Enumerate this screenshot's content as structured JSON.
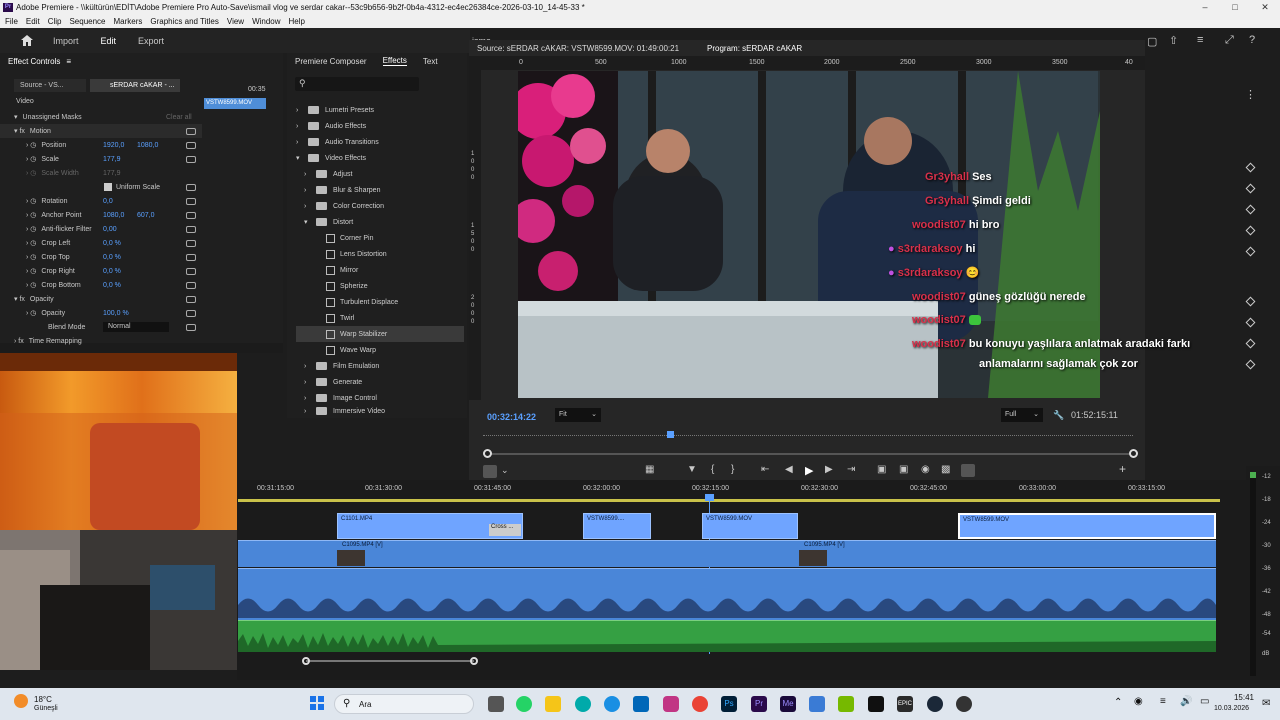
{
  "window": {
    "title": "Adobe Premiere - \\\\kültürün\\EDİT\\Adobe Premiere Pro Auto-Save\\ismail vlog ve serdar cakar--53c9b656-9b2f-0b4a-4312-ec4ec26384ce-2026-03-10_14-45-33 *",
    "logo": "Pr"
  },
  "menu": [
    "File",
    "Edit",
    "Clip",
    "Sequence",
    "Markers",
    "Graphics and Titles",
    "View",
    "Window",
    "Help"
  ],
  "header": {
    "home_icon": "home-icon",
    "import": "Import",
    "edit": "Edit",
    "export": "Export",
    "user": "isma"
  },
  "effect_controls": {
    "title": "Effect Controls",
    "source_tab": "Source - VS...",
    "program_tab": "sERDAR cAKAR - ...",
    "timecode": "00:35",
    "clip_label": "VSTW8599.MOV",
    "section_video": "Video",
    "rows": [
      {
        "label": "Unassigned Masks",
        "value1": "",
        "value2": "",
        "extra": "Clear all"
      },
      {
        "label": "Motion",
        "value1": "",
        "value2": ""
      },
      {
        "label": "Position",
        "value1": "1920,0",
        "value2": "1080,0"
      },
      {
        "label": "Scale",
        "value1": "177,9",
        "value2": ""
      },
      {
        "label": "Scale Width",
        "value1": "177,9",
        "value2": ""
      },
      {
        "label": "Uniform Scale",
        "value1": "",
        "value2": ""
      },
      {
        "label": "Rotation",
        "value1": "0,0",
        "value2": ""
      },
      {
        "label": "Anchor Point",
        "value1": "1080,0",
        "value2": "607,0"
      },
      {
        "label": "Anti-flicker Filter",
        "value1": "0,00",
        "value2": ""
      },
      {
        "label": "Crop Left",
        "value1": "0,0 %",
        "value2": ""
      },
      {
        "label": "Crop Top",
        "value1": "0,0 %",
        "value2": ""
      },
      {
        "label": "Crop Right",
        "value1": "0,0 %",
        "value2": ""
      },
      {
        "label": "Crop Bottom",
        "value1": "0,0 %",
        "value2": ""
      },
      {
        "label": "Opacity",
        "value1": "",
        "value2": ""
      },
      {
        "label": "Opacity",
        "value1": "100,0 %",
        "value2": ""
      },
      {
        "label": "Blend Mode",
        "value1": "Normal",
        "value2": ""
      },
      {
        "label": "Time Remapping",
        "value1": "",
        "value2": ""
      }
    ]
  },
  "effects_panel": {
    "tabs": [
      "Premiere Composer",
      "Effects",
      "Text"
    ],
    "items": [
      {
        "label": "Lumetri Presets",
        "kind": "folder"
      },
      {
        "label": "Audio Effects",
        "kind": "folder"
      },
      {
        "label": "Audio Transitions",
        "kind": "folder"
      },
      {
        "label": "Video Effects",
        "kind": "folder"
      },
      {
        "label": "Adjust",
        "kind": "folder"
      },
      {
        "label": "Blur & Sharpen",
        "kind": "folder"
      },
      {
        "label": "Color Correction",
        "kind": "folder"
      },
      {
        "label": "Distort",
        "kind": "folder"
      },
      {
        "label": "Corner Pin",
        "kind": "fx"
      },
      {
        "label": "Lens Distortion",
        "kind": "fx"
      },
      {
        "label": "Mirror",
        "kind": "fx"
      },
      {
        "label": "Spherize",
        "kind": "fx"
      },
      {
        "label": "Turbulent Displace",
        "kind": "fx"
      },
      {
        "label": "Twirl",
        "kind": "fx"
      },
      {
        "label": "Warp Stabilizer",
        "kind": "fx"
      },
      {
        "label": "Wave Warp",
        "kind": "fx"
      },
      {
        "label": "Film Emulation",
        "kind": "folder"
      },
      {
        "label": "Generate",
        "kind": "folder"
      },
      {
        "label": "Image Control",
        "kind": "folder"
      },
      {
        "label": "Immersive Video",
        "kind": "folder"
      }
    ]
  },
  "monitor": {
    "source_tab": "Source: sERDAR cAKAR: VSTW8599.MOV: 01:49:00:21",
    "program_tab": "Program: sERDAR cAKAR",
    "ruler": [
      "0",
      "500",
      "1000",
      "1500",
      "2000",
      "2500",
      "3000",
      "3500",
      "40"
    ],
    "vruler": [
      "1",
      "0",
      "0",
      "0",
      "1",
      "5",
      "0",
      "0",
      "2",
      "0",
      "0",
      "0"
    ],
    "timecode": "00:32:14:22",
    "fit": "Fit",
    "full": "Full",
    "duration": "01:52:15:11"
  },
  "chat": [
    {
      "user": "Gr3yhall",
      "msg": "Ses"
    },
    {
      "user": "Gr3yhall",
      "msg": "Şimdi geldi"
    },
    {
      "user": "woodist07",
      "msg": "hi bro"
    },
    {
      "user": "s3rdaraksoy",
      "msg": "hi"
    },
    {
      "user": "s3rdaraksoy",
      "msg": "😊"
    },
    {
      "user": "woodist07",
      "msg": "güneş gözlüğü nerede"
    },
    {
      "user": "woodist07",
      "msg": ""
    },
    {
      "user": "woodist07",
      "msg": "bu konuyu yaşlılara anlatmak aradaki farkı"
    },
    {
      "user": "",
      "msg": "anlamalarını sağlamak çok zor"
    }
  ],
  "timeline": {
    "ruler": [
      "00:31:15:00",
      "00:31:30:00",
      "00:31:45:00",
      "00:32:00:00",
      "00:32:15:00",
      "00:32:30:00",
      "00:32:45:00",
      "00:33:00:00",
      "00:33:15:00"
    ],
    "v_clips": [
      "C1101.MP4",
      "VSTW8599....",
      "VSTW8599.MOV",
      "VSTW8599.MOV",
      "Cross ..."
    ],
    "v2_clips": [
      "C1095.MP4 [V]",
      "C1095.MP4 [V]"
    ]
  },
  "meter": {
    "labels": [
      "-12",
      "-18",
      "-24",
      "-30",
      "-36",
      "-42",
      "-48",
      "-54",
      "dB"
    ]
  },
  "taskbar": {
    "weather_temp": "18°C",
    "weather_desc": "Güneşli",
    "search": "Ara",
    "time": "15:41",
    "date": "10.03.2026"
  }
}
